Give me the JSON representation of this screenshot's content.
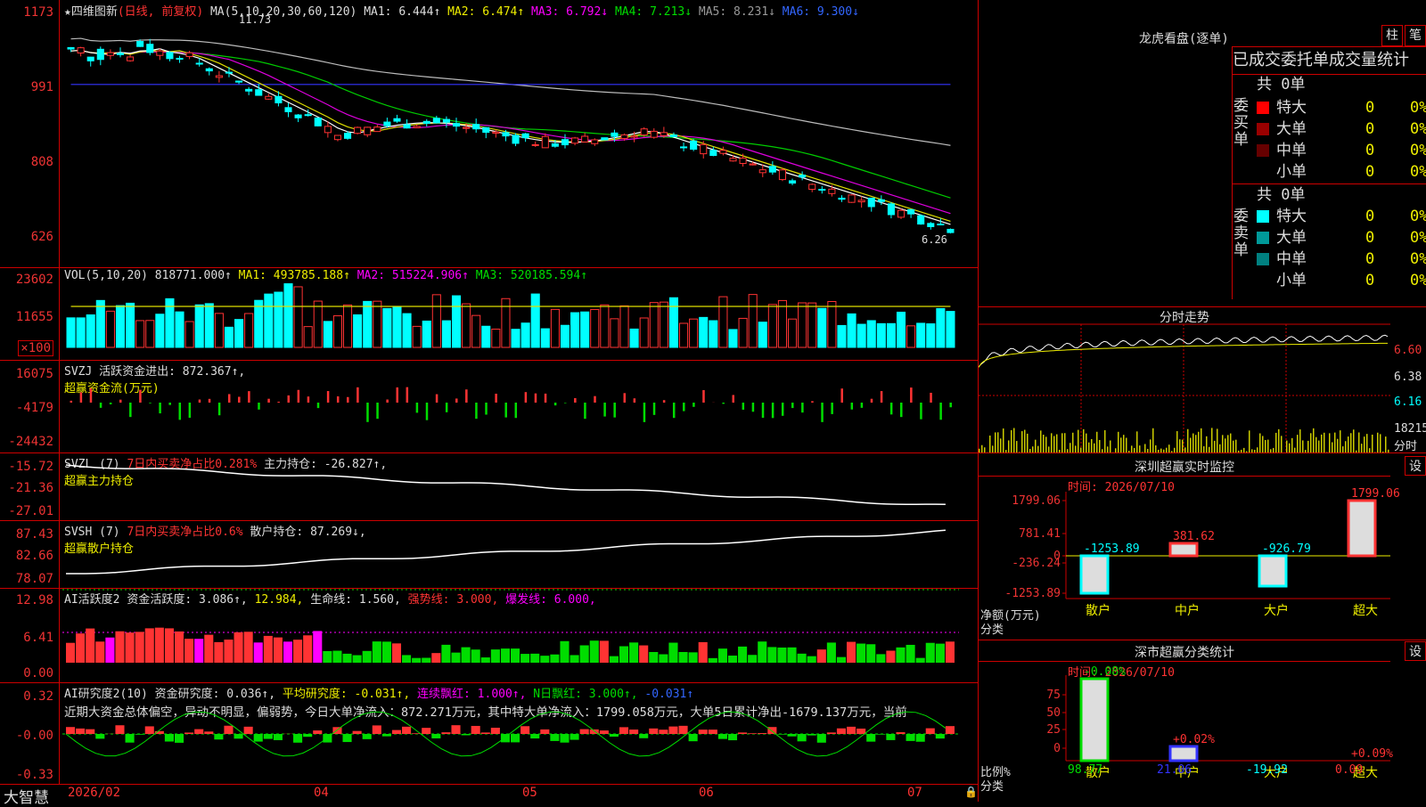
{
  "main": {
    "title": "四维图新",
    "mode": "(日线, 前复权)",
    "ma_label": "MA(5,10,20,30,60,120)",
    "ma1": "MA1: 6.444↑",
    "ma2": "MA2: 6.474↑",
    "ma3": "MA3: 6.792↓",
    "ma4": "MA4: 7.213↓",
    "ma5": "MA5: 8.231↓",
    "ma6": "MA6: 9.300↓",
    "hi_label": "11.73",
    "lo_label": "6.26",
    "yticks": [
      "1173",
      "991",
      "808",
      "626"
    ]
  },
  "vol": {
    "label": "VOL(5,10,20)",
    "value": "818771.000↑",
    "ma1": "MA1: 493785.188↑",
    "ma2": "MA2: 515224.906↑",
    "ma3": "MA3: 520185.594↑",
    "yticks": [
      "23602",
      "11655",
      "×100"
    ]
  },
  "svzj": {
    "label": "SVZJ",
    "value": "活跃资金进出: 872.367↑,",
    "sub": "超赢资金流(万元)",
    "yticks": [
      "16075",
      "-4179",
      "-24432"
    ]
  },
  "svzl": {
    "label": "SVZL (7)",
    "text1": "7日内买卖净占比0.281%",
    "text2": "主力持仓: -26.827↑,",
    "sub": "超赢主力持仓",
    "yticks": [
      "-15.72",
      "-21.36",
      "-27.01"
    ]
  },
  "svsh": {
    "label": "SVSH (7)",
    "text1": "7日内买卖净占比0.6%",
    "text2": "散户持仓: 87.269↓,",
    "sub": "超赢散户持仓",
    "yticks": [
      "87.43",
      "82.66",
      "78.07"
    ]
  },
  "ai1": {
    "label": "AI活跃度2",
    "t1": "资金活跃度: 3.086↑,",
    "t2": "12.984,",
    "t3": "生命线: 1.560,",
    "t4": "强势线: 3.000,",
    "t5": "爆发线: 6.000,",
    "yticks": [
      "12.98",
      "6.41",
      "0.00"
    ]
  },
  "ai2": {
    "label": "AI研究度2(10)",
    "t1": "资金研究度: 0.036↑,",
    "t2": "平均研究度: -0.031↑,",
    "t3": "连续飘红: 1.000↑,",
    "t4": "N日飘红: 3.000↑,",
    "t5": "-0.031↑",
    "text": "近期大资金总体偏空，异动不明显，偏弱势，今日大单净流入：872.271万元，其中特大单净流入：1799.058万元，大单5日累计净出-1679.137万元，当前",
    "yticks": [
      "0.32",
      "-0.00",
      "-0.33"
    ]
  },
  "footer": {
    "brand": "大智慧",
    "dates": [
      "2026/02",
      "04",
      "05",
      "06",
      "07"
    ]
  },
  "lhb": {
    "title": "龙虎看盘(逐单)",
    "btn1": "柱",
    "btn2": "笔",
    "tabs": "已成交委托单成交量统计",
    "buy_side": "委买单",
    "sell_side": "委卖单",
    "buy_total": "共 0单",
    "sell_total": "共 0单",
    "buy_rows": [
      {
        "name": "特大",
        "num": "0",
        "pct": "0%",
        "color": "#ff0000"
      },
      {
        "name": "大单",
        "num": "0",
        "pct": "0%",
        "color": "#990000"
      },
      {
        "name": "中单",
        "num": "0",
        "pct": "0%",
        "color": "#660000"
      },
      {
        "name": "小单",
        "num": "0",
        "pct": "0%",
        "color": "#000000"
      }
    ],
    "sell_rows": [
      {
        "name": "特大",
        "num": "0",
        "pct": "0%",
        "color": "#00ffff"
      },
      {
        "name": "大单",
        "num": "0",
        "pct": "0%",
        "color": "#009999"
      },
      {
        "name": "中单",
        "num": "0",
        "pct": "0%",
        "color": "#008080"
      },
      {
        "name": "小单",
        "num": "0",
        "pct": "0%",
        "color": "#000000"
      }
    ]
  },
  "fs": {
    "title": "分时走势",
    "yticks": [
      "6.60",
      "6.38",
      "6.16",
      "18215",
      "分时"
    ]
  },
  "sz_monitor": {
    "title": "深圳超赢实时监控",
    "btn": "设",
    "time": "时间: 2026/07/10",
    "yticks": [
      "1799.06",
      "781.41",
      "0",
      "-236.24",
      "-1253.89"
    ],
    "ylabel1": "净额(万元)",
    "ylabel2": "分类",
    "categories": [
      "散户",
      "中户",
      "大户",
      "超大"
    ],
    "values": [
      "-1253.89",
      "381.62",
      "-926.79",
      "1799.06"
    ]
  },
  "sz_class": {
    "title": "深市超赢分类统计",
    "btn": "设",
    "time": "时间: 2026/07/10",
    "yticks": [
      "75",
      "50",
      "25",
      "0"
    ],
    "ylabel1": "比例%",
    "ylabel2": "分类",
    "categories": [
      "散户",
      "中户",
      "大户",
      "超大"
    ],
    "values": [
      "98.77",
      "21.06",
      "-19.92",
      "0.09"
    ],
    "top_labels": [
      "-0.08%",
      "+0.02%",
      "",
      "+0.09%"
    ]
  }
}
